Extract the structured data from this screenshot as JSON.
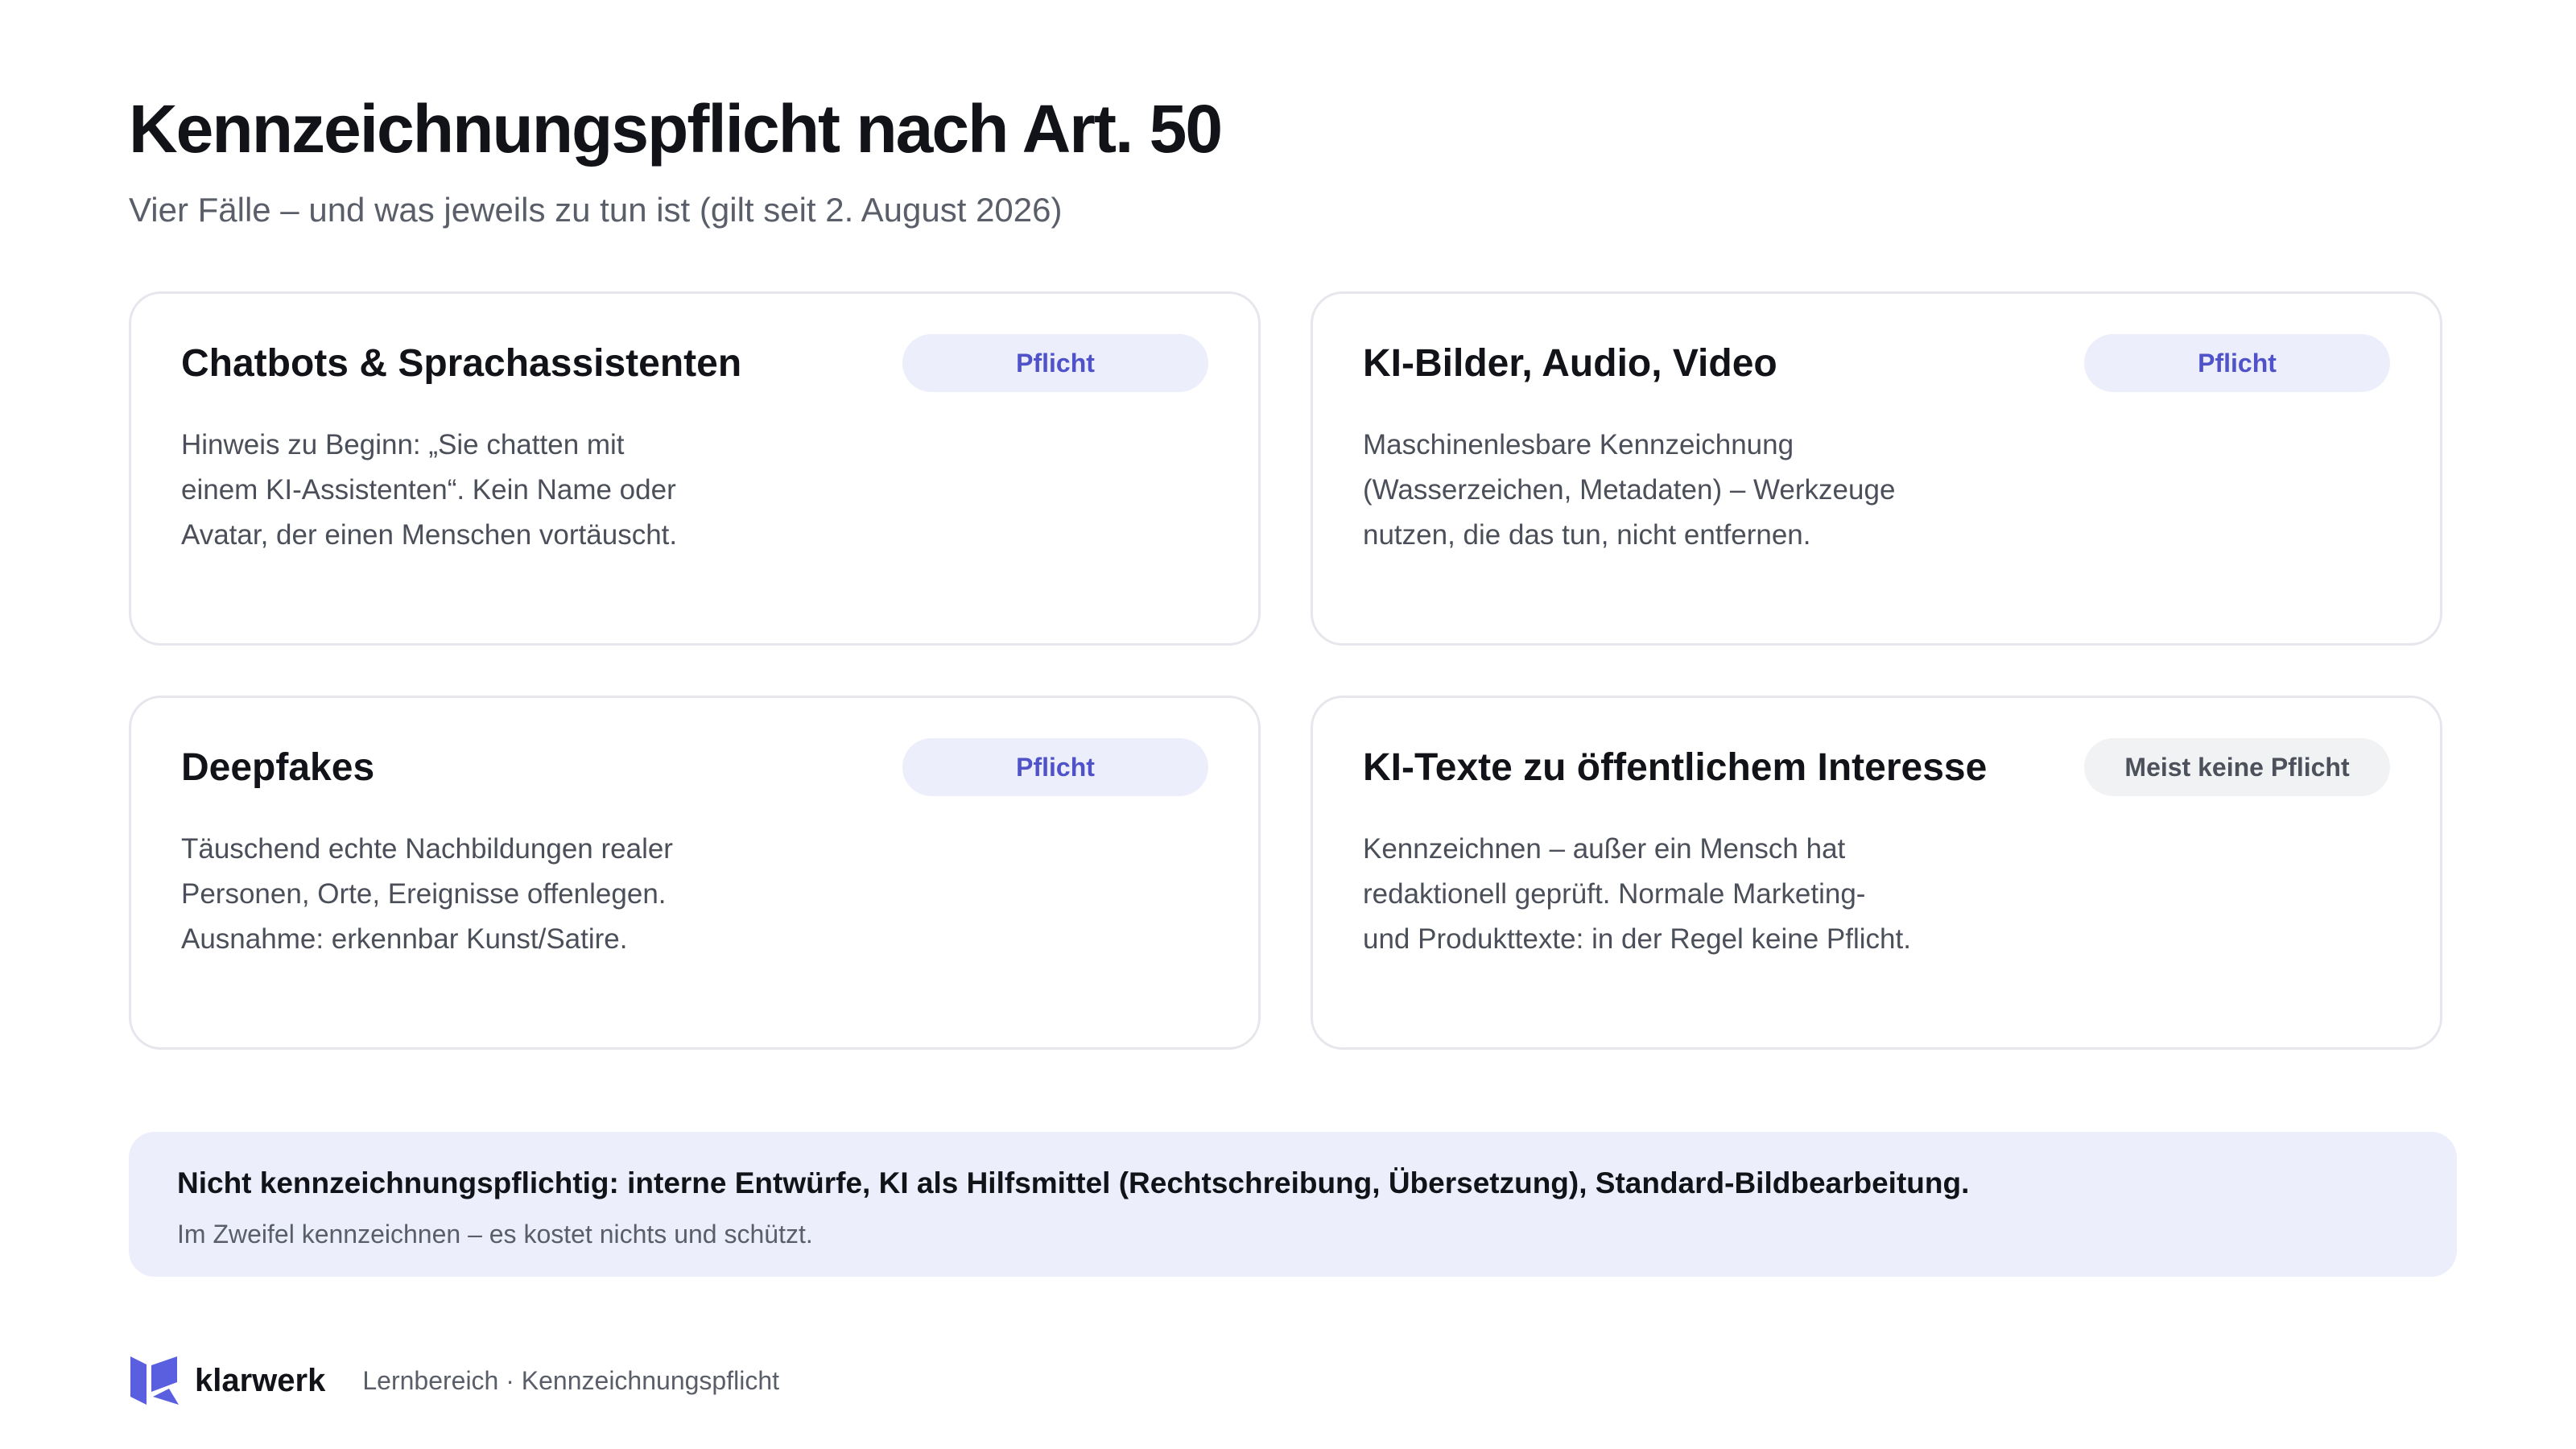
{
  "header": {
    "title": "Kennzeichnungspflicht nach Art. 50",
    "subtitle": "Vier Fälle – und was jeweils zu tun ist (gilt seit 2. August 2026)"
  },
  "cards": [
    {
      "title": "Chatbots & Sprachassistenten",
      "badge": "Pflicht",
      "lines": [
        "Hinweis zu Beginn: „Sie chatten mit",
        "einem KI-Assistenten“. Kein Name oder",
        "Avatar, der einen Menschen vortäuscht."
      ]
    },
    {
      "title": "KI-Bilder, Audio, Video",
      "badge": "Pflicht",
      "lines": [
        "Maschinenlesbare Kennzeichnung",
        "(Wasserzeichen, Metadaten) – Werkzeuge",
        "nutzen, die das tun, nicht entfernen."
      ]
    },
    {
      "title": "Deepfakes",
      "badge": "Pflicht",
      "lines": [
        "Täuschend echte Nachbildungen realer",
        "Personen, Orte, Ereignisse offenlegen.",
        "Ausnahme: erkennbar Kunst/Satire."
      ]
    },
    {
      "title": "KI-Texte zu öffentlichem Interesse",
      "badge": "Meist keine Pflicht",
      "lines": [
        "Kennzeichnen – außer ein Mensch hat",
        "redaktionell geprüft. Normale Marketing-",
        "und Produkttexte: in der Regel keine Pflicht."
      ]
    }
  ],
  "note": {
    "main": "Nicht kennzeichnungspflichtig: interne Entwürfe, KI als Hilfsmittel (Rechtschreibung, Übersetzung), Standard-Bildbearbeitung.",
    "sub": "Im Zweifel kennzeichnen – es kostet nichts und schützt."
  },
  "footer": {
    "brand": "klarwerk",
    "logo_icon": "klarwerk-logo-icon",
    "breadcrumb": "Lernbereich · Kennzeichnungspflicht"
  },
  "colors": {
    "accent": "#4f52c9",
    "accent_bg": "#eceefb",
    "muted_badge_bg": "#f1f2f4",
    "card_border": "#e6e7ec",
    "logo": "#5a5fe0"
  }
}
